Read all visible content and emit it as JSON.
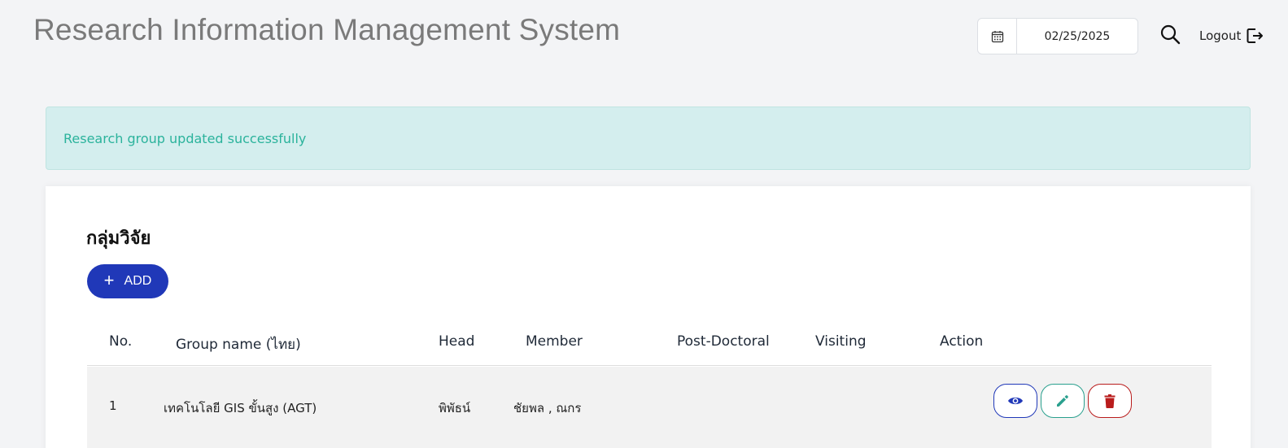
{
  "header": {
    "app_title": "Research Information Management System",
    "date_value": "02/25/2025",
    "logout_label": "Logout"
  },
  "alert": {
    "message": "Research group updated successfully"
  },
  "card": {
    "title": "กลุ่มวิจัย",
    "add_label": "ADD"
  },
  "table": {
    "columns": [
      "No.",
      "Group name (ไทย)",
      "Head",
      "Member",
      "Post-Doctoral",
      "Visiting",
      "Action"
    ],
    "rows": [
      {
        "no": "1",
        "group_name": "เทคโนโลยี GIS ขั้นสูง (AGT)",
        "head": "พิพัธน์",
        "member": "ชัยพล , ณกร",
        "post_doctoral": "",
        "visiting": ""
      }
    ]
  },
  "colors": {
    "primary": "#2038b8",
    "success_text": "#2bb39c",
    "alert_bg": "#d4eeee",
    "edit": "#2aa08e",
    "delete": "#b91c1c"
  },
  "icons": [
    "calendar-icon",
    "search-icon",
    "logout-icon",
    "plus-icon",
    "eye-icon",
    "pencil-icon",
    "trash-icon"
  ]
}
